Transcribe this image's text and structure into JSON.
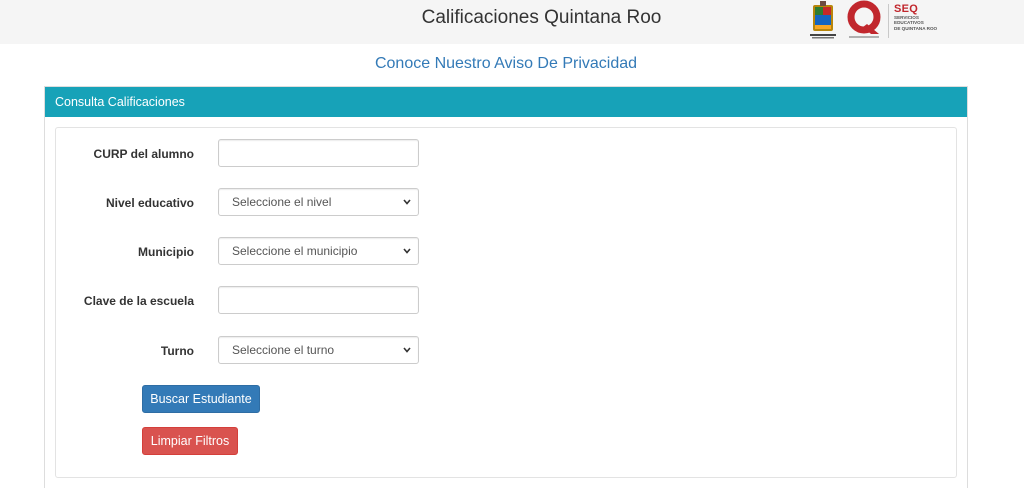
{
  "header": {
    "title": "Calificaciones Quintana Roo",
    "logos": {
      "seq_name": "SEQ",
      "seq_subtitle_lines": [
        "SERVICIOS",
        "EDUCATIVOS",
        "DE QUINTANA ROO"
      ]
    }
  },
  "privacy_link": "Conoce Nuestro Aviso De Privacidad",
  "panel": {
    "heading": "Consulta Calificaciones",
    "fields": {
      "curp": {
        "label": "CURP del alumno",
        "value": ""
      },
      "nivel": {
        "label": "Nivel educativo",
        "selected": "Seleccione el nivel"
      },
      "municipio": {
        "label": "Municipio",
        "selected": "Seleccione el municipio"
      },
      "clave": {
        "label": "Clave de la escuela",
        "value": ""
      },
      "turno": {
        "label": "Turno",
        "selected": "Seleccione el turno"
      }
    },
    "buttons": {
      "search": "Buscar Estudiante",
      "clear": "Limpiar Filtros"
    }
  },
  "colors": {
    "header_bg": "#f5f5f5",
    "panel_heading_bg": "#17a2b8",
    "link": "#337ab7",
    "primary_button": "#337ab7",
    "danger_button": "#d9534f",
    "seq_red": "#c1272d"
  },
  "icons": {
    "crest": "state-coat-of-arms-icon",
    "q_logo": "quintana-roo-q-logo-icon",
    "select_caret": "chevron-down-icon"
  }
}
